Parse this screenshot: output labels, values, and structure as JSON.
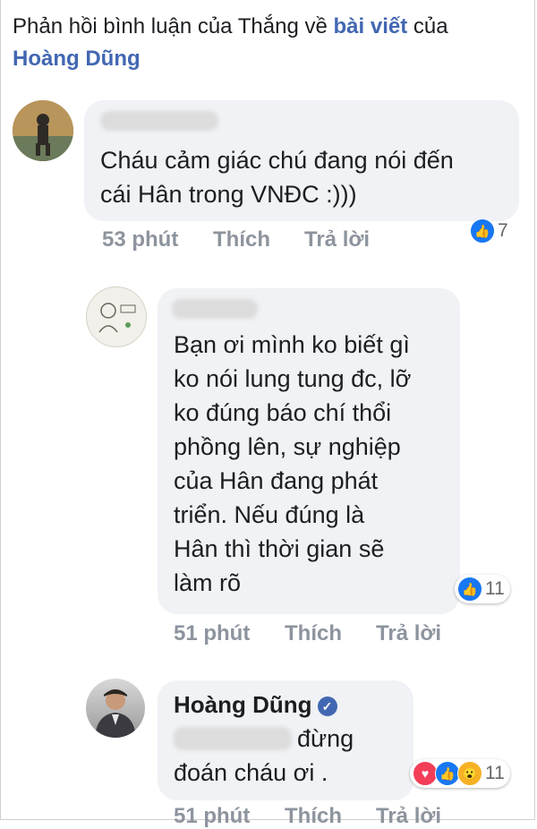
{
  "header": {
    "prefix": "Phản hồi bình luận của Thắng về ",
    "post_link": "bài viết",
    "middle": " của ",
    "author_link": "Hoàng Dũng"
  },
  "comments": [
    {
      "text_lines": [
        "Cháu cảm giác chú đang nói đến",
        "cái Hân trong VNĐC :)))"
      ],
      "time": "53 phút",
      "like_label": "Thích",
      "reply_label": "Trả lời",
      "reaction_count": "7",
      "reactions": [
        "like-icon"
      ]
    },
    {
      "text_lines": [
        "Bạn ơi mình ko biết gì",
        "ko nói lung tung đc, lỡ",
        "ko đúng báo chí thổi",
        "phồng lên, sự nghiệp",
        "của Hân đang phát",
        "triển. Nếu đúng là",
        "Hân thì thời gian sẽ",
        "làm rõ"
      ],
      "time": "51 phút",
      "like_label": "Thích",
      "reply_label": "Trả lời",
      "reaction_count": "11",
      "reactions": [
        "like-icon"
      ]
    },
    {
      "author": "Hoàng Dũng",
      "text_line1_suffix": "đừng",
      "text_line2": "đoán cháu ơi .",
      "time": "51 phút",
      "like_label": "Thích",
      "reply_label": "Trả lời",
      "reaction_count": "11",
      "reactions": [
        "love-icon",
        "like-icon",
        "wow-icon"
      ]
    }
  ],
  "colors": {
    "link": "#4267b2",
    "bubble": "#f0f2f5",
    "meta": "#8d949e"
  }
}
